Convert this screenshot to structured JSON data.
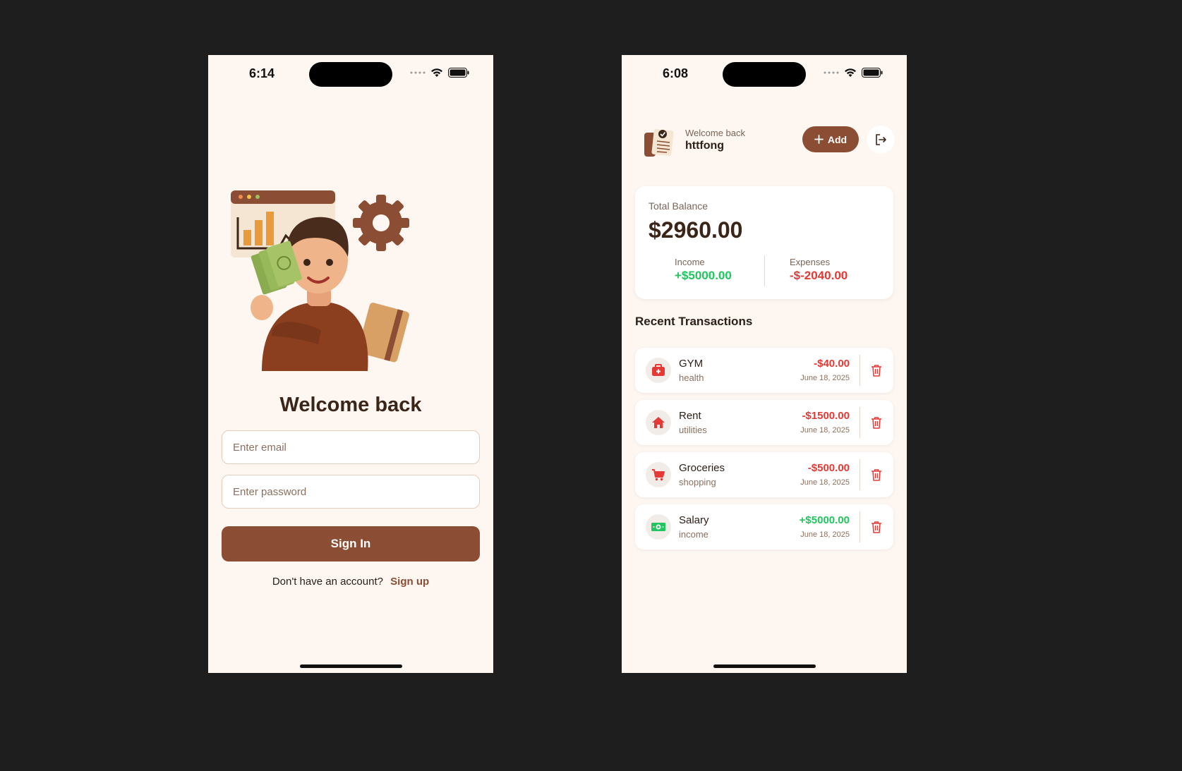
{
  "login_screen": {
    "status_time": "6:14",
    "title": "Welcome back",
    "email_placeholder": "Enter email",
    "password_placeholder": "Enter password",
    "sign_in_label": "Sign In",
    "no_account_text": "Don't have an account?",
    "sign_up_label": "Sign up"
  },
  "home_screen": {
    "status_time": "6:08",
    "greeting": "Welcome back",
    "username": "httfong",
    "add_label": "Add",
    "balance": {
      "label": "Total Balance",
      "value": "$2960.00",
      "income_label": "Income",
      "income_value": "+$5000.00",
      "expenses_label": "Expenses",
      "expenses_value": "-$-2040.00"
    },
    "recent_title": "Recent Transactions",
    "transactions": [
      {
        "name": "GYM",
        "category": "health",
        "amount": "-$40.00",
        "date": "June 18, 2025",
        "icon": "first-aid-kit-icon",
        "color": "#e53935"
      },
      {
        "name": "Rent",
        "category": "utilities",
        "amount": "-$1500.00",
        "date": "June 18, 2025",
        "icon": "house-icon",
        "color": "#e53935"
      },
      {
        "name": "Groceries",
        "category": "shopping",
        "amount": "-$500.00",
        "date": "June 18, 2025",
        "icon": "shopping-cart-icon",
        "color": "#e53935"
      },
      {
        "name": "Salary",
        "category": "income",
        "amount": "+$5000.00",
        "date": "June 18, 2025",
        "icon": "cash-icon",
        "color": "#22c55e"
      }
    ]
  },
  "colors": {
    "background": "#1e1e1e",
    "phone_bg": "#fdf6f1",
    "accent": "#8b4e34",
    "income": "#22c55e",
    "expense": "#e53935"
  }
}
